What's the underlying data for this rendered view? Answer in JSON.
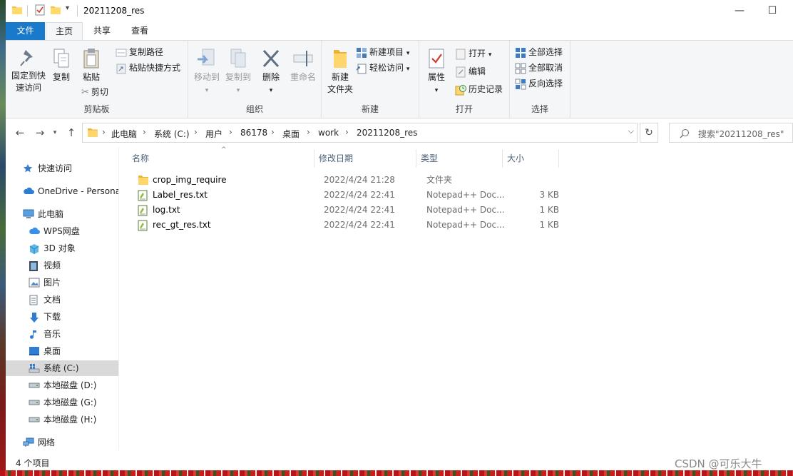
{
  "window": {
    "title": "20211208_res",
    "controls": {
      "minimize": "—",
      "maximize": "☐"
    }
  },
  "ribbon_tabs": [
    "文件",
    "主页",
    "共享",
    "查看"
  ],
  "ribbon": {
    "clipboard": {
      "label": "剪贴板",
      "pin_line1": "固定到快",
      "pin_line2": "速访问",
      "copy": "复制",
      "paste": "粘贴",
      "copy_path": "复制路径",
      "paste_shortcut": "粘贴快捷方式",
      "cut": "剪切"
    },
    "organize": {
      "label": "组织",
      "move_to": "移动到",
      "copy_to": "复制到",
      "delete": "删除",
      "rename": "重命名"
    },
    "new": {
      "label": "新建",
      "new_folder_line1": "新建",
      "new_folder_line2": "文件夹",
      "new_item": "新建项目",
      "easy_access": "轻松访问"
    },
    "open": {
      "label": "打开",
      "properties": "属性",
      "open": "打开",
      "edit": "编辑",
      "history": "历史记录"
    },
    "select": {
      "label": "选择",
      "select_all": "全部选择",
      "select_none": "全部取消",
      "invert": "反向选择"
    }
  },
  "address": {
    "crumbs": [
      "此电脑",
      "系统 (C:)",
      "用户",
      "86178",
      "桌面",
      "work",
      "20211208_res"
    ],
    "search_placeholder": "搜索\"20211208_res\""
  },
  "nav": [
    {
      "label": "快速访问",
      "icon": "star-icon",
      "selected": false
    },
    {
      "label": "OneDrive - Personal",
      "icon": "cloud-icon",
      "selected": false
    },
    {
      "label": "此电脑",
      "icon": "computer-icon",
      "selected": false
    },
    {
      "label": "WPS网盘",
      "icon": "wps-cloud-icon",
      "selected": false
    },
    {
      "label": "3D 对象",
      "icon": "cube-icon",
      "selected": false
    },
    {
      "label": "视频",
      "icon": "video-icon",
      "selected": false
    },
    {
      "label": "图片",
      "icon": "picture-icon",
      "selected": false
    },
    {
      "label": "文档",
      "icon": "document-icon",
      "selected": false
    },
    {
      "label": "下载",
      "icon": "download-icon",
      "selected": false
    },
    {
      "label": "音乐",
      "icon": "music-icon",
      "selected": false
    },
    {
      "label": "桌面",
      "icon": "desktop-icon",
      "selected": false
    },
    {
      "label": "系统 (C:)",
      "icon": "system-drive-icon",
      "selected": true
    },
    {
      "label": "本地磁盘 (D:)",
      "icon": "drive-icon",
      "selected": false
    },
    {
      "label": "本地磁盘 (G:)",
      "icon": "drive-icon",
      "selected": false
    },
    {
      "label": "本地磁盘 (H:)",
      "icon": "drive-icon",
      "selected": false
    },
    {
      "label": "网络",
      "icon": "network-icon",
      "selected": false
    }
  ],
  "columns": {
    "name": "名称",
    "modified": "修改日期",
    "type": "类型",
    "size": "大小"
  },
  "files": [
    {
      "name": "crop_img_require",
      "modified": "2022/4/24 21:28",
      "type": "文件夹",
      "size": "",
      "icon": "folder-icon"
    },
    {
      "name": "Label_res.txt",
      "modified": "2022/4/24 22:41",
      "type": "Notepad++ Doc...",
      "size": "3 KB",
      "icon": "notepad-file-icon"
    },
    {
      "name": "log.txt",
      "modified": "2022/4/24 22:41",
      "type": "Notepad++ Doc...",
      "size": "1 KB",
      "icon": "notepad-file-icon"
    },
    {
      "name": "rec_gt_res.txt",
      "modified": "2022/4/24 22:41",
      "type": "Notepad++ Doc...",
      "size": "1 KB",
      "icon": "notepad-file-icon"
    }
  ],
  "status": {
    "count": "4 个项目"
  },
  "watermark": "CSDN @可乐大牛",
  "colors": {
    "accent": "#1979ca",
    "ribbon_bg": "#f5f6f7",
    "selected_bg": "#d9d9d9",
    "folder": "#f4c542"
  }
}
